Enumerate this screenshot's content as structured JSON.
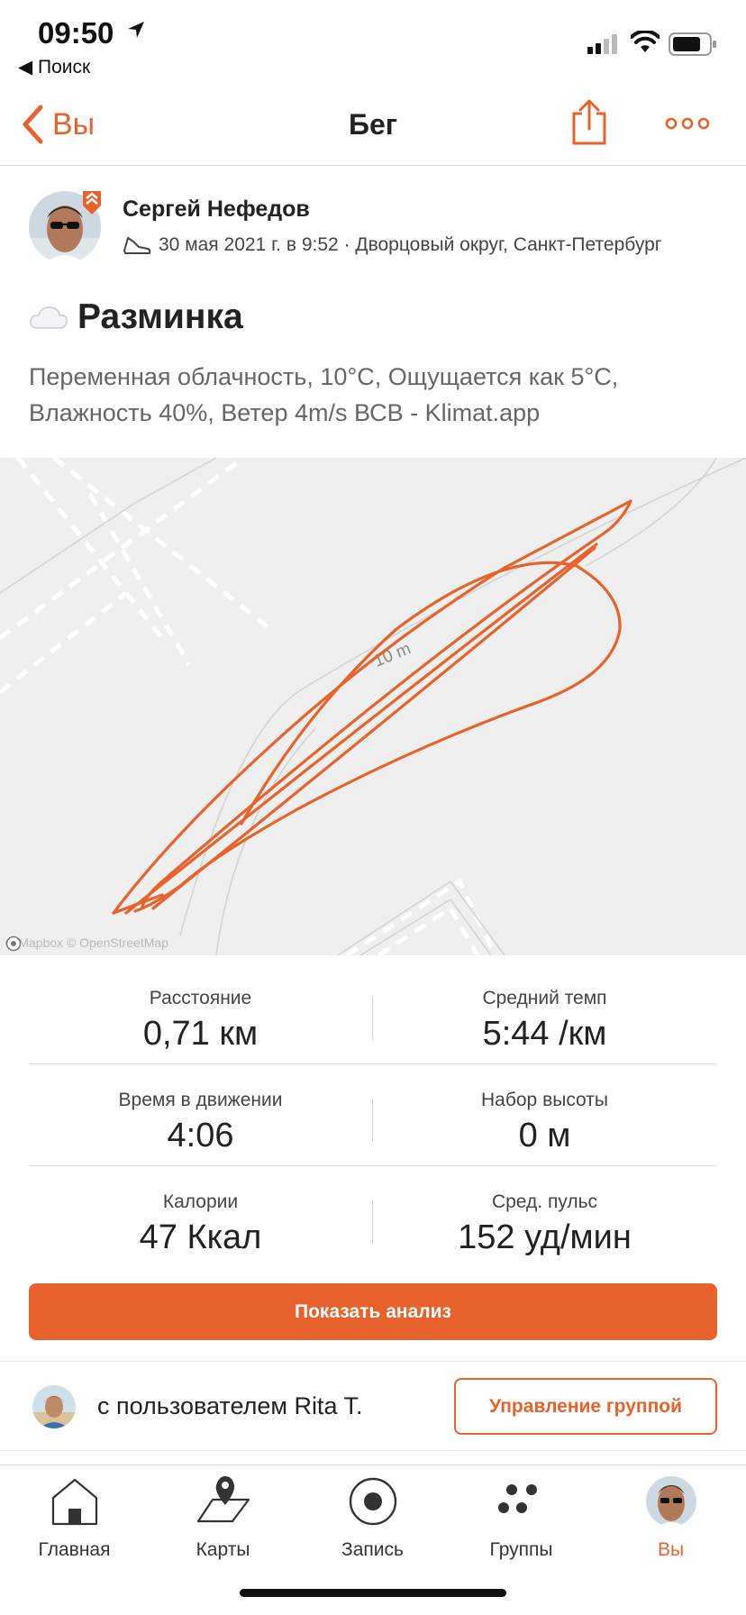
{
  "status_bar": {
    "time": "09:50",
    "back_app": "◀ Поиск"
  },
  "nav": {
    "back_label": "Вы",
    "title": "Бег"
  },
  "activity": {
    "athlete": "Сергей Нефедов",
    "meta": "30 мая 2021 г. в 9:52 · Дворцовый округ, Санкт-Петербург",
    "title": "Разминка",
    "description": "Переменная облачность, 10°C, Ощущается как 5°C, Влажность 40%, Ветер 4m/s  ВСВ - Klimat.app"
  },
  "map": {
    "scale_label": "10 m",
    "attribution": "© Mapbox © OpenStreetMap"
  },
  "stats": [
    {
      "left_label": "Расстояние",
      "left_value": "0,71 км",
      "right_label": "Средний темп",
      "right_value": "5:44 /км"
    },
    {
      "left_label": "Время в движении",
      "left_value": "4:06",
      "right_label": "Набор высоты",
      "right_value": "0 м"
    },
    {
      "left_label": "Калории",
      "left_value": "47 Ккал",
      "right_label": "Сред. пульс",
      "right_value": "152 уд/мин"
    }
  ],
  "analysis_button": "Показать анализ",
  "group": {
    "text": "с пользователем Rita T.",
    "button": "Управление группой"
  },
  "tabs": [
    {
      "label": "Главная",
      "icon": "home-icon"
    },
    {
      "label": "Карты",
      "icon": "map-pin-icon"
    },
    {
      "label": "Запись",
      "icon": "record-icon"
    },
    {
      "label": "Группы",
      "icon": "groups-icon"
    },
    {
      "label": "Вы",
      "icon": "profile-avatar",
      "active": true
    }
  ],
  "colors": {
    "accent": "#e8632c",
    "route": "#e8632c",
    "map_bg": "#efefef"
  }
}
